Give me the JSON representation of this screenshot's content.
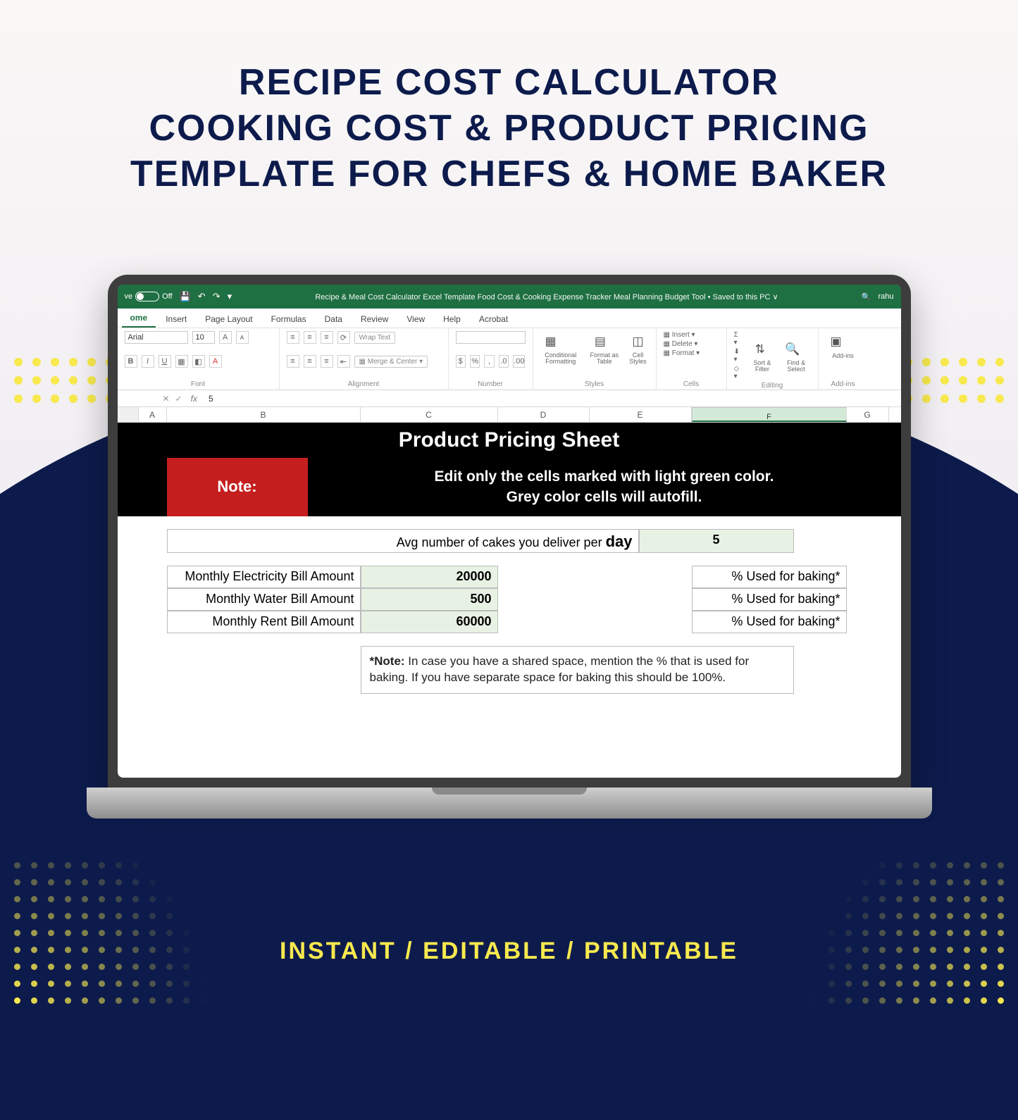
{
  "promo": {
    "headline_l1": "RECIPE COST CALCULATOR",
    "headline_l2": "COOKING COST & PRODUCT PRICING",
    "headline_l3": "TEMPLATE FOR CHEFS & HOME BAKER",
    "tagline": "INSTANT / EDITABLE / PRINTABLE"
  },
  "titlebar": {
    "autosave_label": "ve",
    "autosave_state": "Off",
    "doc_title": "Recipe & Meal Cost Calculator  Excel Template  Food Cost & Cooking Expense Tracker  Meal Planning Budget Tool • Saved to this PC ∨",
    "user": "rahu"
  },
  "ribbon": {
    "tabs": [
      "ome",
      "Insert",
      "Page Layout",
      "Formulas",
      "Data",
      "Review",
      "View",
      "Help",
      "Acrobat"
    ],
    "active_tab": "ome",
    "font_name": "Arial",
    "font_size": "10",
    "merge_label": "Merge & Center",
    "wrap_label": "Wrap Text",
    "groups": {
      "font": "Font",
      "alignment": "Alignment",
      "number": "Number",
      "styles": "Styles",
      "cells": "Cells",
      "editing": "Editing",
      "addins": "Add-ins"
    },
    "styles_items": [
      "Conditional Formatting",
      "Format as Table",
      "Cell Styles"
    ],
    "cells_items": [
      "Insert",
      "Delete",
      "Format"
    ],
    "editing_items": [
      "Sort & Filter",
      "Find & Select"
    ],
    "addins_item": "Add-ins"
  },
  "formula_bar": {
    "namebox": "",
    "fx": "fx",
    "value": "5"
  },
  "columns": [
    "A",
    "B",
    "C",
    "D",
    "E",
    "F",
    "G"
  ],
  "sheet": {
    "title": "Product Pricing Sheet",
    "note_label": "Note:",
    "note_text_l1": "Edit only the cells marked with light green color.",
    "note_text_l2": "Grey color cells will autofill.",
    "avg_label_pre": "Avg number of cakes you deliver per ",
    "avg_label_bold": "day",
    "avg_value": "5",
    "rows": [
      {
        "label": "Monthly Electricity Bill Amount",
        "value": "20000",
        "pct_label": "% Used for baking*"
      },
      {
        "label": "Monthly Water Bill Amount",
        "value": "500",
        "pct_label": "% Used for baking*"
      },
      {
        "label": "Monthly Rent Bill Amount",
        "value": "60000",
        "pct_label": "% Used for baking*"
      }
    ],
    "footnote_bold": "*Note:",
    "footnote_text": " In case you have a shared space, mention the % that is used for baking. If you have separate space for baking this should be 100%."
  }
}
